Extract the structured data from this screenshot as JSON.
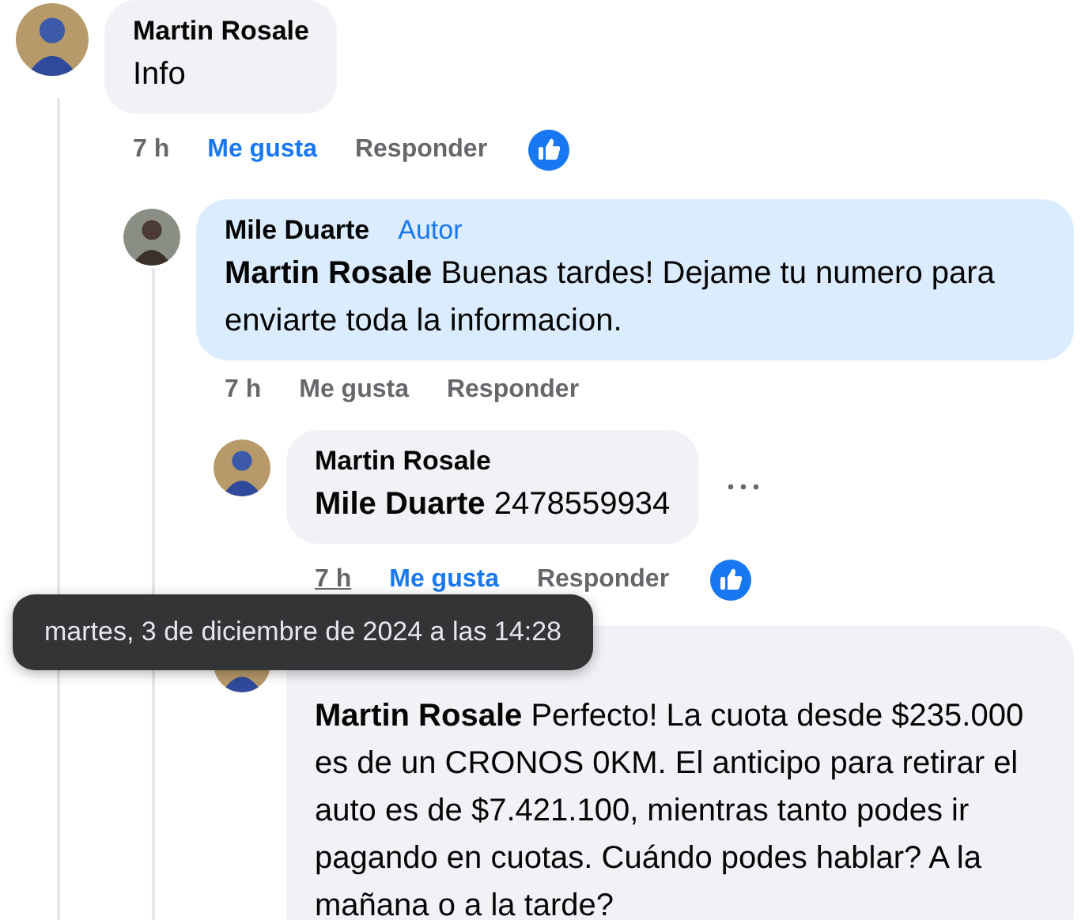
{
  "comments": [
    {
      "author": "Martin Rosale",
      "text": "Info",
      "highlighted": false,
      "time": "7 h",
      "time_hovered": false,
      "like_label": "Me gusta",
      "liked": true,
      "reply_label": "Responder",
      "reaction_shown": true,
      "more_menu": false,
      "children": [
        {
          "author": "Mile Duarte",
          "badge": "Autor",
          "mention": "Martin Rosale",
          "text": "Buenas tardes! Dejame tu numero para enviarte toda la informacion.",
          "highlighted": true,
          "time": "7 h",
          "time_hovered": false,
          "like_label": "Me gusta",
          "liked": false,
          "reply_label": "Responder",
          "reaction_shown": false,
          "more_menu": false,
          "children": [
            {
              "author": "Martin Rosale",
              "mention": "Mile Duarte",
              "text": "2478559934",
              "highlighted": false,
              "time": "7 h",
              "time_hovered": true,
              "like_label": "Me gusta",
              "liked": true,
              "reply_label": "Responder",
              "reaction_shown": true,
              "more_menu": true
            },
            {
              "mention": "Martin Rosale",
              "text": "Perfecto! La cuota desde $235.000 es de un CRONOS 0KM. El anticipo para retirar el auto es de $7.421.100, mientras tanto podes ir pagando en cuotas. Cuándo podes hablar? A la mañana o a la tarde?",
              "highlighted": false,
              "more_menu": false
            }
          ]
        }
      ]
    }
  ],
  "tooltip": {
    "text": "martes, 3 de diciembre de 2024 a las 14:28"
  }
}
